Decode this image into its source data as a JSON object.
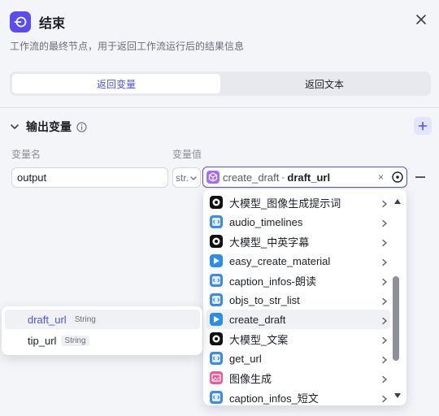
{
  "header": {
    "title": "结束",
    "description": "工作流的最终节点，用于返回工作流运行后的结果信息"
  },
  "tabs": [
    {
      "label": "返回变量",
      "active": true
    },
    {
      "label": "返回文本",
      "active": false
    }
  ],
  "output_section": {
    "title": "输出变量"
  },
  "columns": {
    "name": "变量名",
    "value": "变量值"
  },
  "row": {
    "name_value": "output",
    "type_value": "str.",
    "ref_node": "create_draft",
    "ref_sep": "-",
    "ref_var": "draft_url",
    "clear_symbol": "×"
  },
  "dropdown_items": [
    {
      "label": "大模型_图像生成提示词",
      "icon": "llm-icon",
      "color": "#111111"
    },
    {
      "label": "audio_timelines",
      "icon": "code-icon",
      "color": "#3d8be8"
    },
    {
      "label": "大模型_中英字幕",
      "icon": "llm-icon",
      "color": "#111111"
    },
    {
      "label": "easy_create_material",
      "icon": "plugin-icon",
      "color": "#2b8de6"
    },
    {
      "label": "caption_infos-朗读",
      "icon": "code-icon",
      "color": "#3d8be8"
    },
    {
      "label": "objs_to_str_list",
      "icon": "code-icon",
      "color": "#3d8be8"
    },
    {
      "label": "create_draft",
      "icon": "plugin-icon",
      "color": "#2b8de6",
      "hover": true
    },
    {
      "label": "大模型_文案",
      "icon": "llm-icon",
      "color": "#111111"
    },
    {
      "label": "get_url",
      "icon": "code-icon",
      "color": "#3d8be8"
    },
    {
      "label": "图像生成",
      "icon": "image-gen-icon",
      "color": "#e85a9a"
    },
    {
      "label": "caption_infos_短文",
      "icon": "code-icon",
      "color": "#3d8be8"
    }
  ],
  "sub_menu": [
    {
      "name": "draft_url",
      "type": "String",
      "active": true
    },
    {
      "name": "tip_url",
      "type": "String",
      "active": false
    }
  ],
  "colors": {
    "accent": "#4d53e8",
    "node_icon": "#5b4cf0",
    "ref_badge": "#a66cf5"
  }
}
